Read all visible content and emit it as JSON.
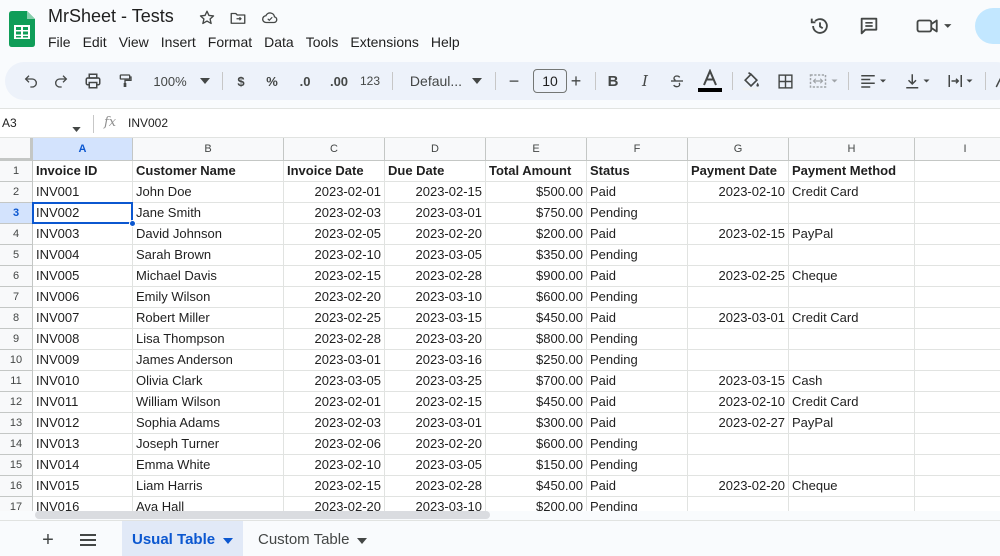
{
  "app": {
    "title": "MrSheet - Tests",
    "menus": [
      "File",
      "Edit",
      "View",
      "Insert",
      "Format",
      "Data",
      "Tools",
      "Extensions",
      "Help"
    ],
    "colors": {
      "accent": "#0b57d0",
      "logo": "#0f9d58",
      "selected_header": "#d3e3fd"
    }
  },
  "toolbar": {
    "zoom": "100%",
    "currency": "$",
    "percent": "%",
    "dec_decrease": ".0",
    "dec_increase": ".00",
    "number_format": "123",
    "font": "Defaul...",
    "font_size": "10"
  },
  "formula_bar": {
    "name_box": "A3",
    "fx": "fx",
    "value": "INV002"
  },
  "columns": [
    "A",
    "B",
    "C",
    "D",
    "E",
    "F",
    "G",
    "H",
    "I"
  ],
  "rows": [
    {
      "num": "1",
      "cells": [
        "Invoice ID",
        "Customer Name",
        "Invoice Date",
        "Due Date",
        "Total Amount",
        "Status",
        "Payment Date",
        "Payment Method"
      ]
    },
    {
      "num": "2",
      "cells": [
        "INV001",
        "John Doe",
        "2023-02-01",
        "2023-02-15",
        "$500.00",
        "Paid",
        "2023-02-10",
        "Credit Card"
      ]
    },
    {
      "num": "3",
      "cells": [
        "INV002",
        "Jane Smith",
        "2023-02-03",
        "2023-03-01",
        "$750.00",
        "Pending",
        "",
        ""
      ]
    },
    {
      "num": "4",
      "cells": [
        "INV003",
        "David Johnson",
        "2023-02-05",
        "2023-02-20",
        "$200.00",
        "Paid",
        "2023-02-15",
        "PayPal"
      ]
    },
    {
      "num": "5",
      "cells": [
        "INV004",
        "Sarah Brown",
        "2023-02-10",
        "2023-03-05",
        "$350.00",
        "Pending",
        "",
        ""
      ]
    },
    {
      "num": "6",
      "cells": [
        "INV005",
        "Michael Davis",
        "2023-02-15",
        "2023-02-28",
        "$900.00",
        "Paid",
        "2023-02-25",
        "Cheque"
      ]
    },
    {
      "num": "7",
      "cells": [
        "INV006",
        "Emily Wilson",
        "2023-02-20",
        "2023-03-10",
        "$600.00",
        "Pending",
        "",
        ""
      ]
    },
    {
      "num": "8",
      "cells": [
        "INV007",
        "Robert Miller",
        "2023-02-25",
        "2023-03-15",
        "$450.00",
        "Paid",
        "2023-03-01",
        "Credit Card"
      ]
    },
    {
      "num": "9",
      "cells": [
        "INV008",
        "Lisa Thompson",
        "2023-02-28",
        "2023-03-20",
        "$800.00",
        "Pending",
        "",
        ""
      ]
    },
    {
      "num": "10",
      "cells": [
        "INV009",
        "James Anderson",
        "2023-03-01",
        "2023-03-16",
        "$250.00",
        "Pending",
        "",
        ""
      ]
    },
    {
      "num": "11",
      "cells": [
        "INV010",
        "Olivia Clark",
        "2023-03-05",
        "2023-03-25",
        "$700.00",
        "Paid",
        "2023-03-15",
        "Cash"
      ]
    },
    {
      "num": "12",
      "cells": [
        "INV011",
        "William Wilson",
        "2023-02-01",
        "2023-02-15",
        "$450.00",
        "Paid",
        "2023-02-10",
        "Credit Card"
      ]
    },
    {
      "num": "13",
      "cells": [
        "INV012",
        "Sophia Adams",
        "2023-02-03",
        "2023-03-01",
        "$300.00",
        "Paid",
        "2023-02-27",
        "PayPal"
      ]
    },
    {
      "num": "14",
      "cells": [
        "INV013",
        "Joseph Turner",
        "2023-02-06",
        "2023-02-20",
        "$600.00",
        "Pending",
        "",
        ""
      ]
    },
    {
      "num": "15",
      "cells": [
        "INV014",
        "Emma White",
        "2023-02-10",
        "2023-03-05",
        "$150.00",
        "Pending",
        "",
        ""
      ]
    },
    {
      "num": "16",
      "cells": [
        "INV015",
        "Liam Harris",
        "2023-02-15",
        "2023-02-28",
        "$450.00",
        "Paid",
        "2023-02-20",
        "Cheque"
      ]
    },
    {
      "num": "17",
      "cells": [
        "INV016",
        "Ava Hall",
        "2023-02-20",
        "2023-03-10",
        "$200.00",
        "Pending",
        "",
        ""
      ]
    }
  ],
  "selection": {
    "cell": "A3",
    "row": 3,
    "col": 0
  },
  "sheets": {
    "tabs": [
      "Usual Table",
      "Custom Table"
    ],
    "active": 0
  }
}
